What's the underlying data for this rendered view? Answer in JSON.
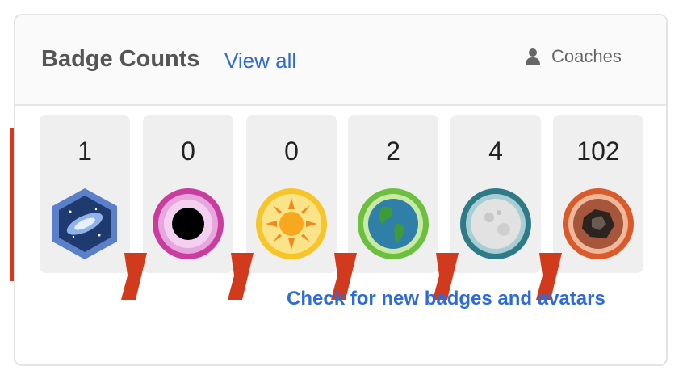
{
  "header": {
    "title": "Badge Counts",
    "view_all": "View all",
    "coaches": "Coaches"
  },
  "badges": [
    {
      "count": "1",
      "icon": "galaxy-badge-icon"
    },
    {
      "count": "0",
      "icon": "black-hole-badge-icon"
    },
    {
      "count": "0",
      "icon": "sun-badge-icon"
    },
    {
      "count": "2",
      "icon": "earth-badge-icon"
    },
    {
      "count": "4",
      "icon": "moon-badge-icon"
    },
    {
      "count": "102",
      "icon": "meteorite-badge-icon"
    }
  ],
  "footer": {
    "check_link": "Check for new badges and avatars"
  },
  "colors": {
    "link": "#2f6bd3",
    "bracket_red": "#d23a1e",
    "tile_bg": "#efefef"
  }
}
